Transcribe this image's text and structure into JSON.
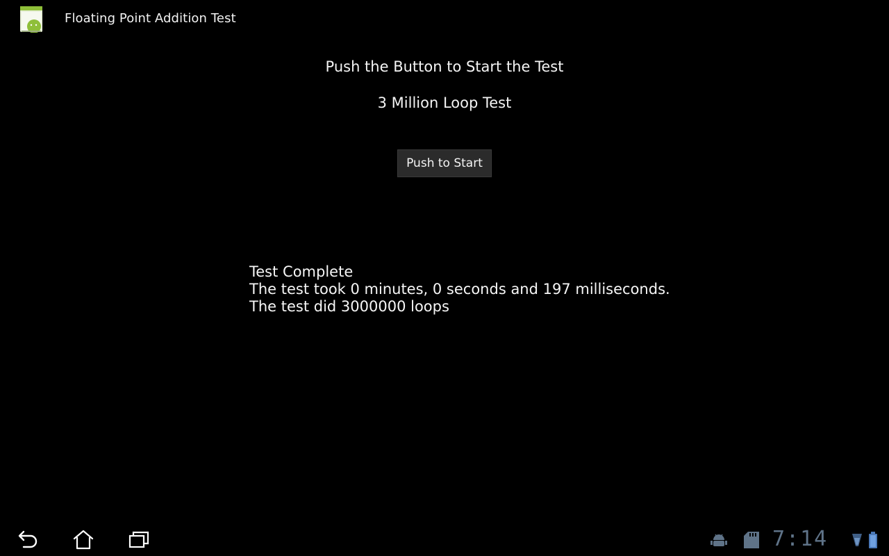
{
  "app": {
    "title": "Floating Point Addition Test",
    "icon": "android-app-icon"
  },
  "main": {
    "instruction": "Push the Button to Start the Test",
    "test_name": "3 Million Loop Test",
    "start_button_label": "Push to Start",
    "results": [
      "Test Complete",
      "The test took 0 minutes, 0 seconds and 197 milliseconds.",
      "The test did 3000000 loops"
    ]
  },
  "system_bar": {
    "nav": [
      "back-icon",
      "home-icon",
      "recent-apps-icon"
    ],
    "status_icons": [
      "android-debug-icon",
      "sd-card-icon",
      "wifi-icon",
      "battery-icon"
    ],
    "clock": "7:14",
    "clock_color": "#5f7388"
  },
  "colors": {
    "background": "#000000",
    "button_bg": "#2b2b2b",
    "text": "#f4f4f4"
  }
}
